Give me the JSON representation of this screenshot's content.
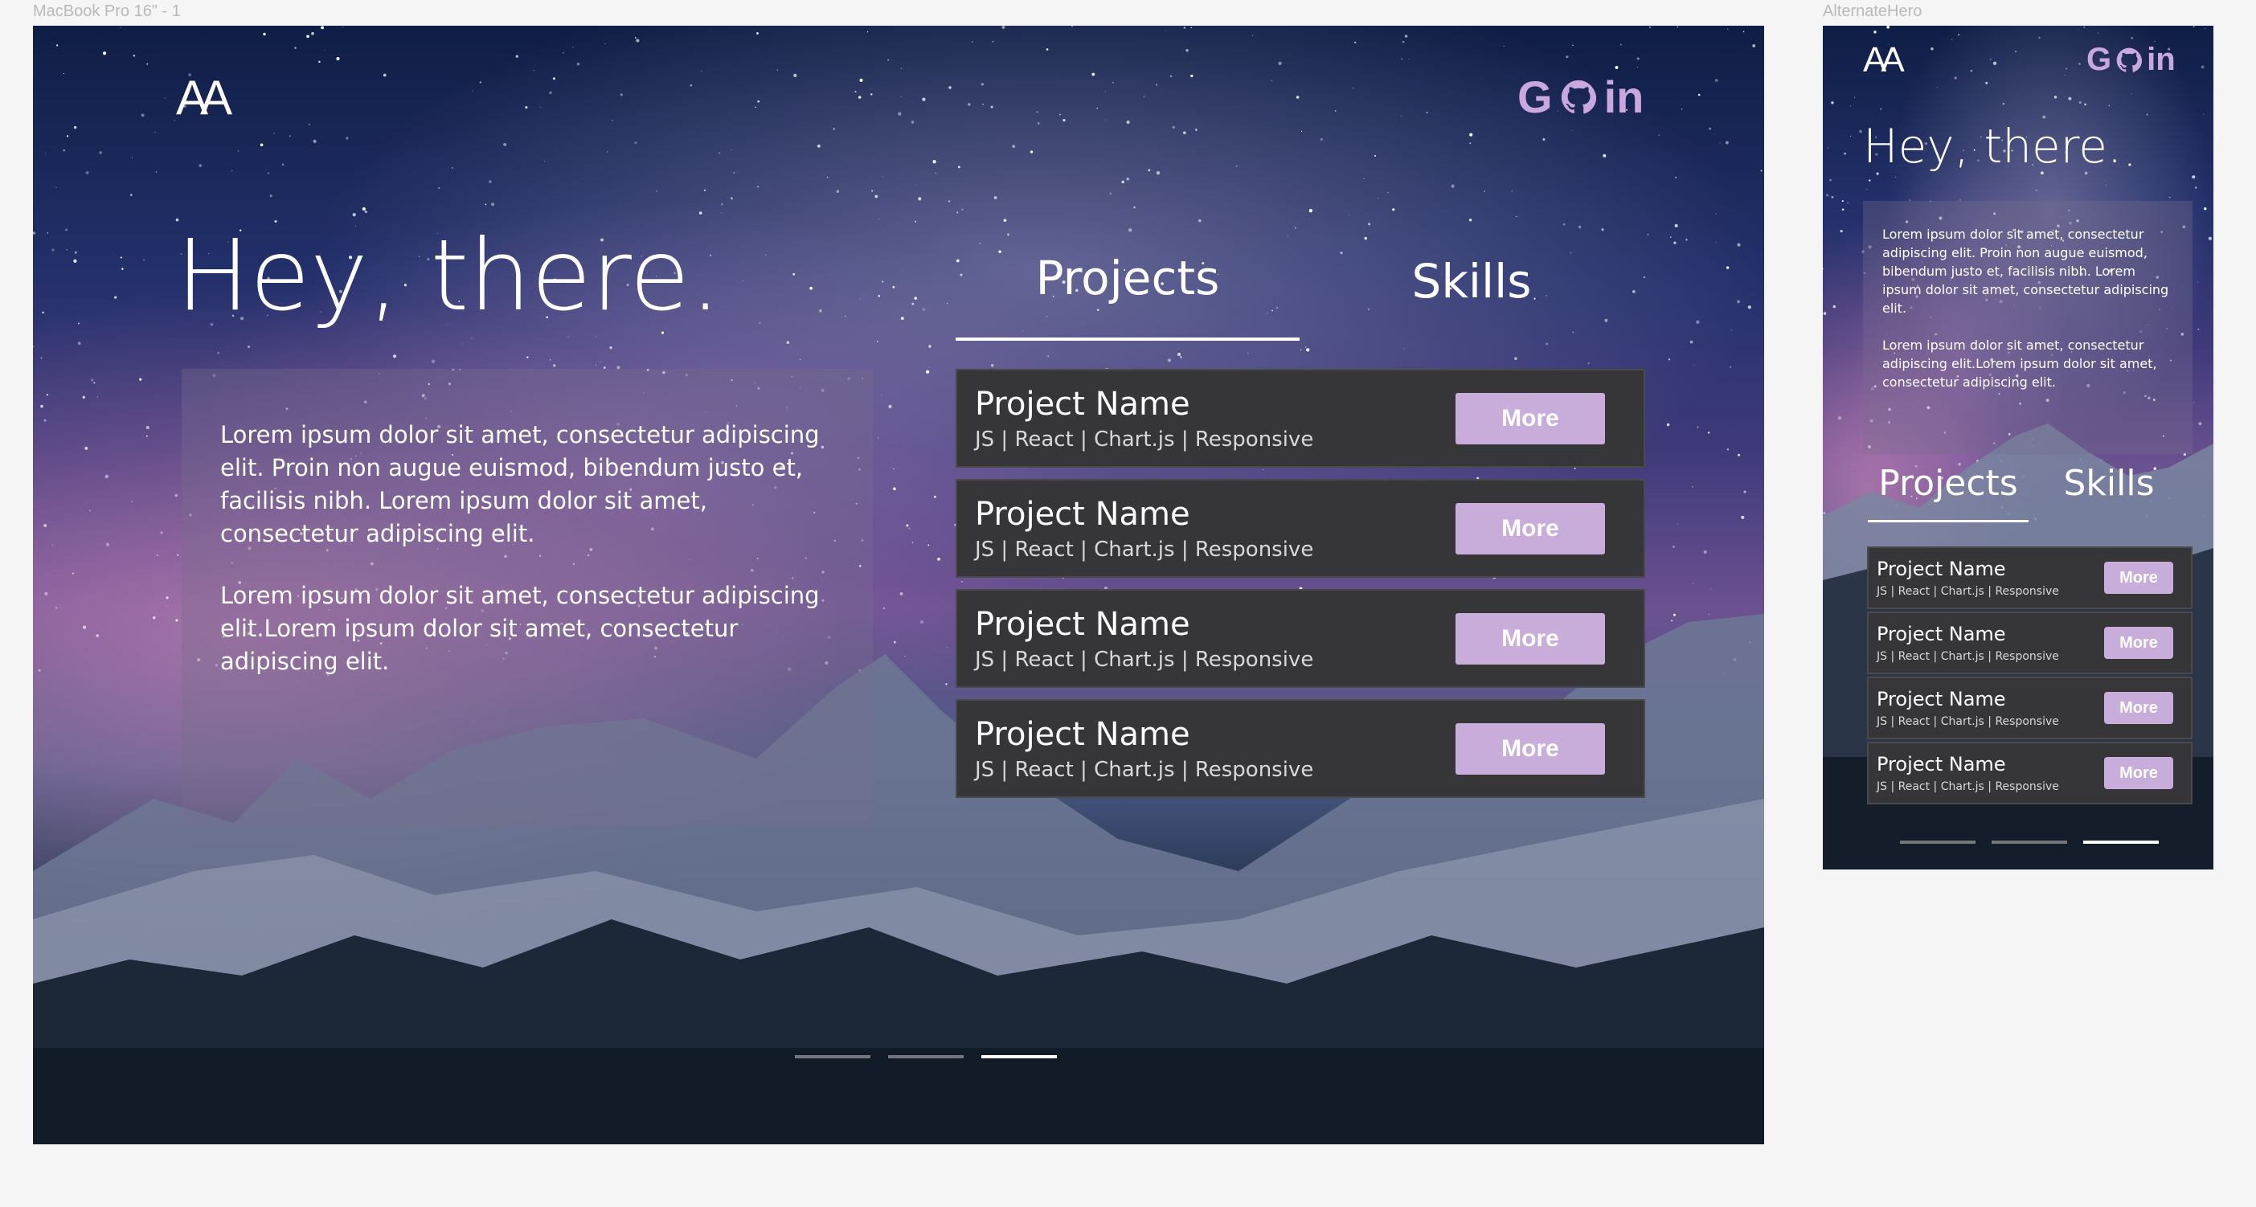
{
  "frames": {
    "desktop_label": "MacBook Pro 16\" - 1",
    "mobile_label": "AlternateHero"
  },
  "logo": "AA",
  "social": {
    "google": "G",
    "github": "github-icon",
    "linkedin": "in"
  },
  "hero": {
    "title": "Hey, there.",
    "paragraph1": "Lorem ipsum dolor sit amet, consectetur adipiscing elit. Proin non augue euismod, bibendum justo et, facilisis nibh. Lorem ipsum dolor sit amet, consectetur adipiscing elit.",
    "paragraph2": "Lorem ipsum dolor sit amet, consectetur adipiscing elit.Lorem ipsum dolor sit amet, consectetur adipiscing elit."
  },
  "tabs": {
    "projects": "Projects",
    "skills": "Skills",
    "active": "Projects"
  },
  "projects": [
    {
      "name": "Project Name",
      "tags": "JS | React | Chart.js | Responsive",
      "button": "More"
    },
    {
      "name": "Project Name",
      "tags": "JS | React | Chart.js | Responsive",
      "button": "More"
    },
    {
      "name": "Project Name",
      "tags": "JS | React | Chart.js | Responsive",
      "button": "More"
    },
    {
      "name": "Project Name",
      "tags": "JS | React | Chart.js | Responsive",
      "button": "More"
    }
  ],
  "pagination": {
    "count": 3,
    "active_index": 2
  },
  "colors": {
    "accent": "#c8acd9",
    "card_bg": "#363638",
    "text": "#ffffff"
  }
}
